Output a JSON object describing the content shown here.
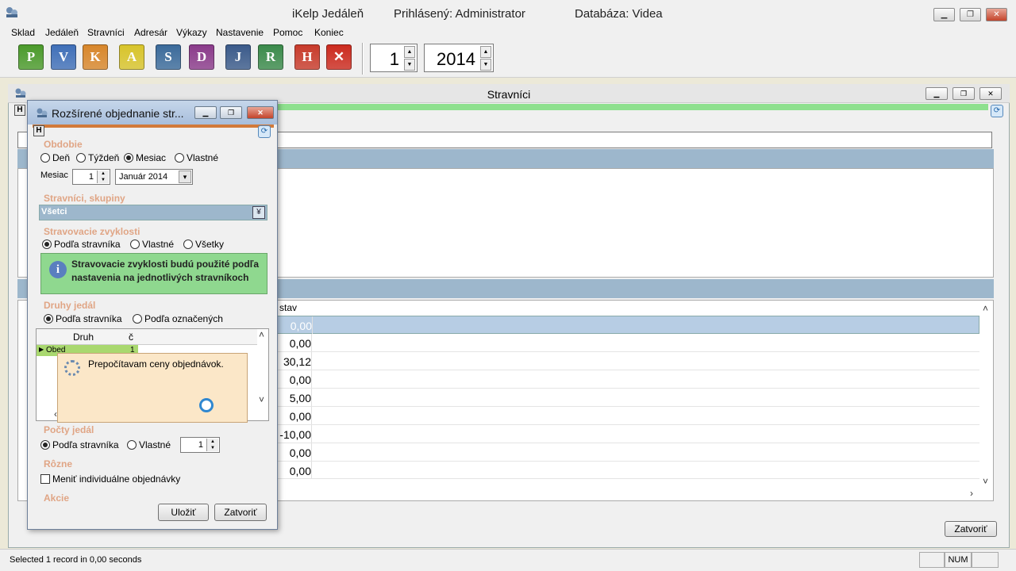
{
  "window": {
    "title": "iKelp Jedáleň",
    "logged_in": "Prihlásený: Administrator",
    "database": "Databáza: Videa"
  },
  "menu": [
    "Sklad",
    "Jedáleň",
    "Stravníci",
    "Adresár",
    "Výkazy",
    "Nastavenie",
    "Pomoc",
    "Koniec"
  ],
  "toolbar": {
    "buttons": [
      {
        "letter": "P",
        "color": "#4a9a2a"
      },
      {
        "letter": "V",
        "color": "#3f6fb8"
      },
      {
        "letter": "K",
        "color": "#d8862a"
      },
      {
        "letter": "A",
        "color": "#d8c42a"
      },
      {
        "letter": "S",
        "color": "#3a6a9a"
      },
      {
        "letter": "D",
        "color": "#8a3a8a"
      },
      {
        "letter": "J",
        "color": "#3a5a8a"
      },
      {
        "letter": "R",
        "color": "#3a8a4a"
      },
      {
        "letter": "H",
        "color": "#c83a2a"
      },
      {
        "letter": "✕",
        "color": "#cc2a1e"
      }
    ],
    "month_value": "1",
    "year_value": "2014"
  },
  "mdi": {
    "title": "Stravníci",
    "badge": "H",
    "grid_header": "stav",
    "values": [
      "0,00",
      "0,00",
      "30,12",
      "0,00",
      "5,00",
      "0,00",
      "-10,00",
      "0,00",
      "0,00"
    ],
    "close_label": "Zatvoriť"
  },
  "dialog": {
    "title": "Rozšírené objednanie str...",
    "badge": "H",
    "obdobie_title": "Obdobie",
    "period_options": [
      "Deň",
      "Týždeň",
      "Mesiac",
      "Vlastné"
    ],
    "period_selected": "Mesiac",
    "month_label": "Mesiac",
    "month_value": "1",
    "month_combo": "Január 2014",
    "stravnici_title": "Stravníci, skupiny",
    "stravnici_value": "Všetci",
    "zvyklosti_title": "Stravovacie zvyklosti",
    "zvyklosti_options": [
      "Podľa stravníka",
      "Vlastné",
      "Všetky"
    ],
    "zvyklosti_selected": "Podľa stravníka",
    "info_line1": "Stravovacie zvyklosti budú použité podľa",
    "info_line2": "nastavenia na jednotlivých stravníkoch",
    "druhy_title": "Druhy jedál",
    "druhy_options": [
      "Podľa stravníka",
      "Podľa označených"
    ],
    "druhy_selected": "Podľa stravníka",
    "grid_col_druh": "Druh",
    "grid_col_c": "č",
    "grid_row_name": "Obed",
    "grid_row_c": "1",
    "busy_message": "Prepočítavam ceny objednávok.",
    "pocty_title": "Počty jedál",
    "pocty_options": [
      "Podľa stravníka",
      "Vlastné"
    ],
    "pocty_selected": "Podľa stravníka",
    "pocty_value": "1",
    "rozne_title": "Rôzne",
    "rozne_checkbox": "Meniť individuálne objednávky",
    "akcie_title": "Akcie",
    "save_label": "Uložiť",
    "close_label": "Zatvoriť"
  },
  "status": {
    "text": "Selected 1 record in 0,00 seconds",
    "num": "NUM"
  }
}
